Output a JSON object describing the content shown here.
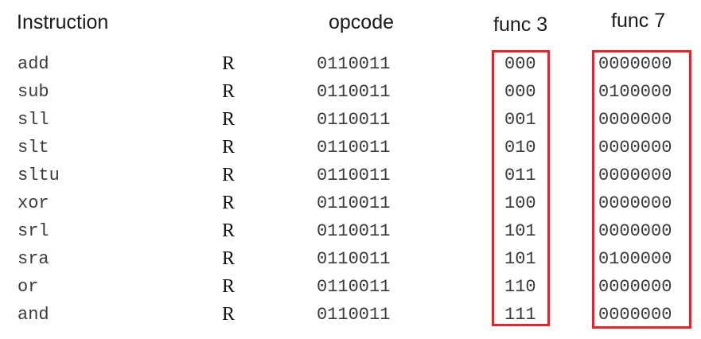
{
  "headers": {
    "instruction": "Instruction",
    "opcode": "opcode",
    "func3": "func 3",
    "func7": "func 7"
  },
  "rows": [
    {
      "name": "add",
      "type": "R",
      "opcode": "0110011",
      "func3": "000",
      "func7": "0000000"
    },
    {
      "name": "sub",
      "type": "R",
      "opcode": "0110011",
      "func3": "000",
      "func7": "0100000"
    },
    {
      "name": "sll",
      "type": "R",
      "opcode": "0110011",
      "func3": "001",
      "func7": "0000000"
    },
    {
      "name": "slt",
      "type": "R",
      "opcode": "0110011",
      "func3": "010",
      "func7": "0000000"
    },
    {
      "name": "sltu",
      "type": "R",
      "opcode": "0110011",
      "func3": "011",
      "func7": "0000000"
    },
    {
      "name": "xor",
      "type": "R",
      "opcode": "0110011",
      "func3": "100",
      "func7": "0000000"
    },
    {
      "name": "srl",
      "type": "R",
      "opcode": "0110011",
      "func3": "101",
      "func7": "0000000"
    },
    {
      "name": "sra",
      "type": "R",
      "opcode": "0110011",
      "func3": "101",
      "func7": "0100000"
    },
    {
      "name": "or",
      "type": "R",
      "opcode": "0110011",
      "func3": "110",
      "func7": "0000000"
    },
    {
      "name": "and",
      "type": "R",
      "opcode": "0110011",
      "func3": "111",
      "func7": "0000000"
    }
  ],
  "colors": {
    "highlight": "#e0262c"
  }
}
